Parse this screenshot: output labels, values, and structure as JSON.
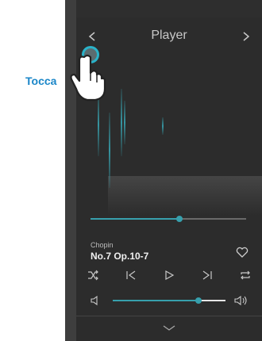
{
  "header": {
    "title": "Player"
  },
  "track": {
    "artist": "Chopin",
    "title": "No.7 Op.10-7"
  },
  "playback": {
    "progress": 0.57,
    "volume": 0.76
  },
  "hint": {
    "label": "Tocca"
  },
  "colors": {
    "accent": "#37a0ad",
    "tap": "#2ab3c9",
    "label": "#1a86c8"
  },
  "icons": {
    "back": "chevron-left-icon",
    "forward": "chevron-right-icon",
    "favorite": "heart-icon",
    "shuffle": "shuffle-icon",
    "previous": "skip-previous-icon",
    "play": "play-icon",
    "next": "skip-next-icon",
    "repeat": "repeat-icon",
    "volume_low": "volume-low-icon",
    "volume_high": "volume-high-icon",
    "collapse": "chevron-down-icon",
    "hand": "pointing-hand-icon"
  }
}
